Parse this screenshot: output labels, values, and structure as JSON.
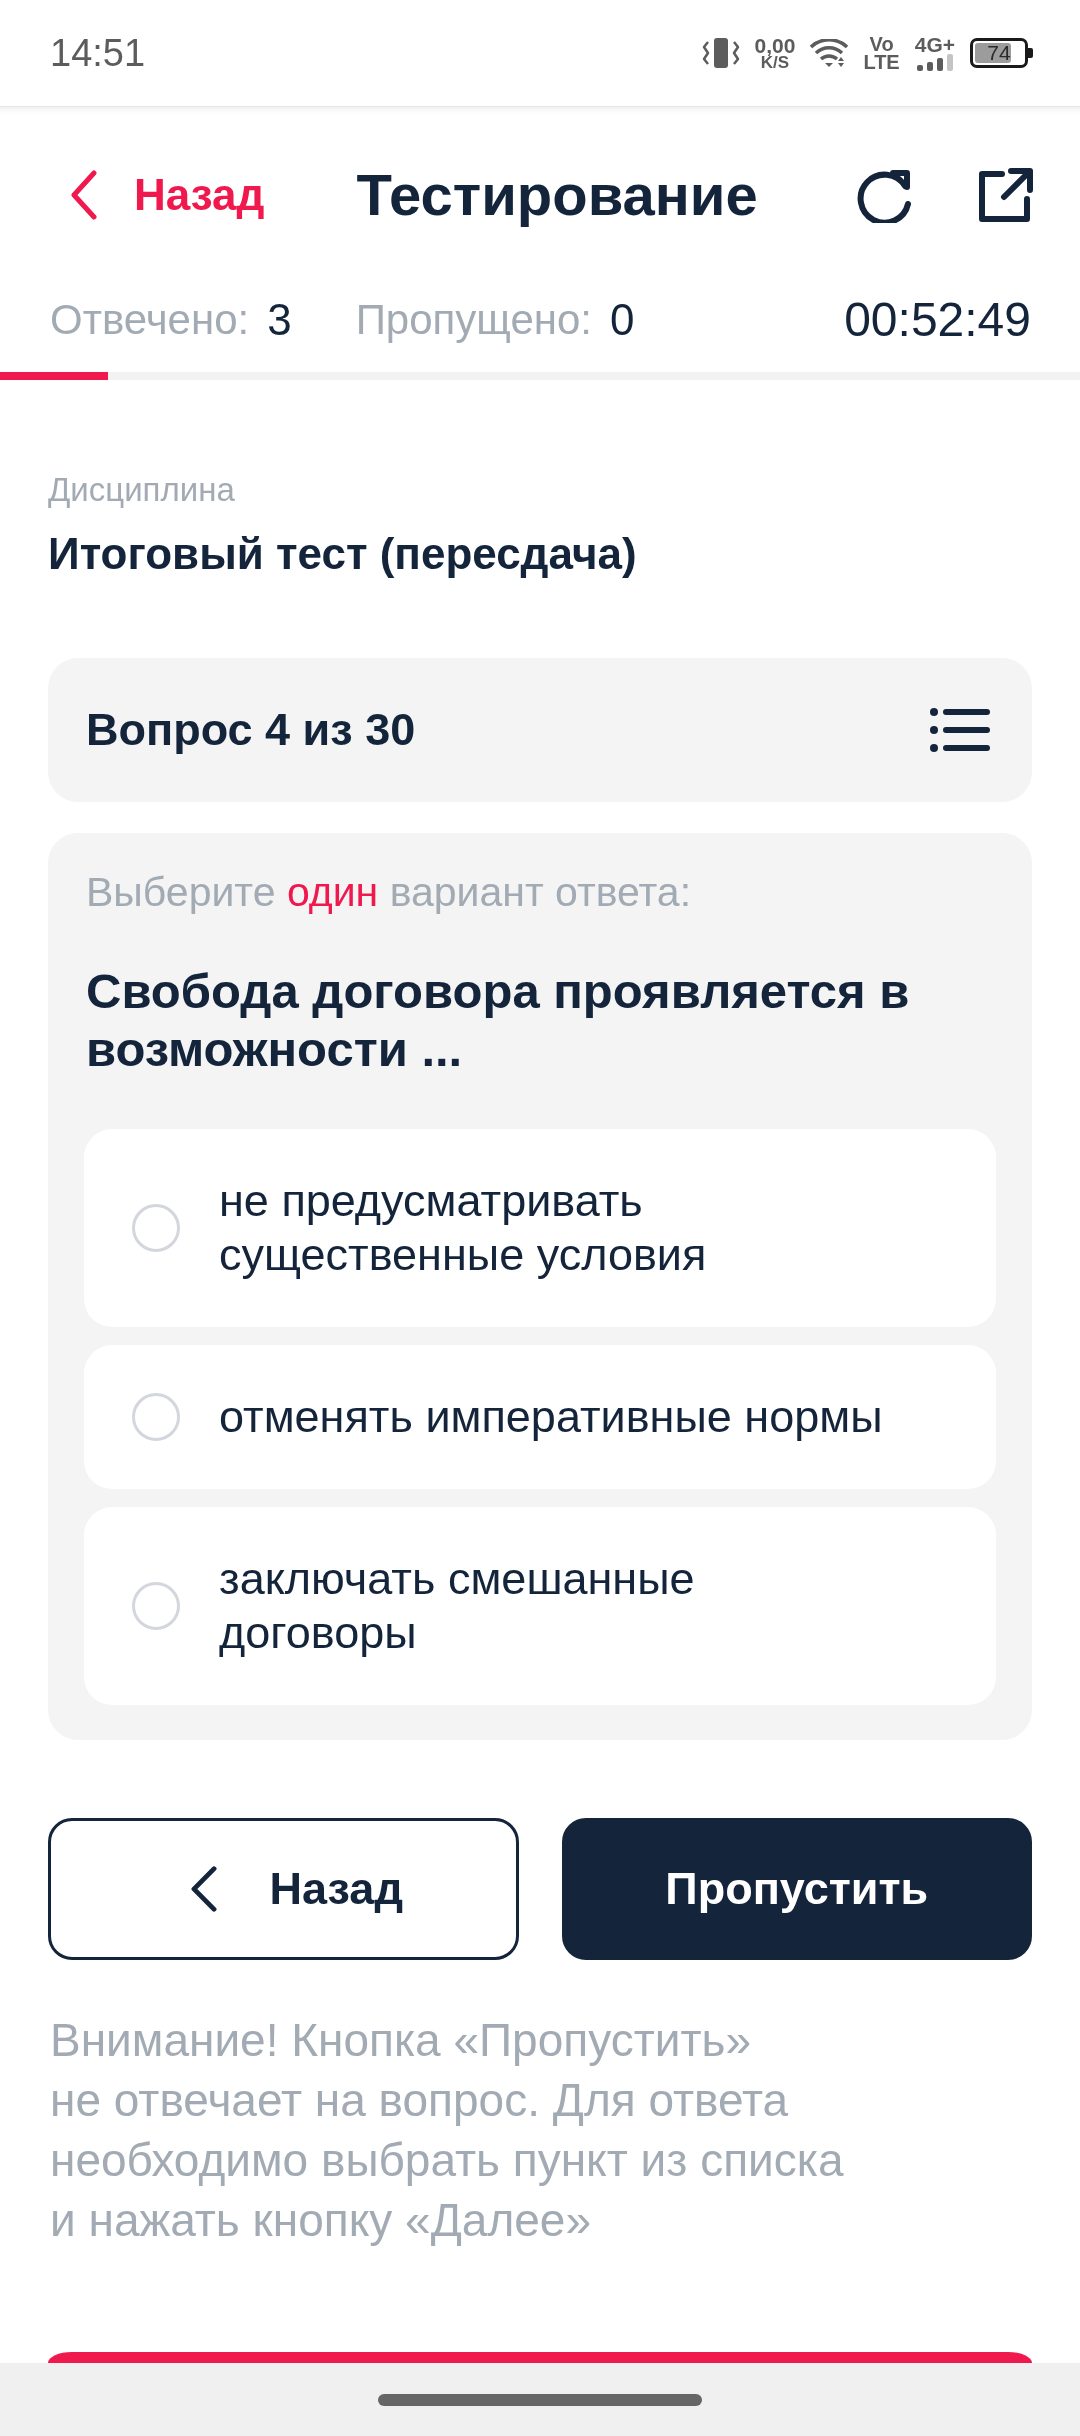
{
  "status_bar": {
    "time": "14:51",
    "network_speed": "0,00",
    "network_speed_unit": "K/S",
    "volte_top": "Vo",
    "volte_bottom": "LTE",
    "network_type": "4G+",
    "battery": "74"
  },
  "header": {
    "back": "Назад",
    "title": "Тестирование"
  },
  "stats": {
    "answered_label": "Отвечено:",
    "answered": "3",
    "skipped_label": "Пропущено:",
    "skipped": "0",
    "timer": "00:52:49"
  },
  "progress": {
    "level": 0.1
  },
  "discipline": {
    "label": "Дисциплина",
    "value": "Итоговый тест (пересдача)"
  },
  "question_header": {
    "title": "Вопрос 4 из 30"
  },
  "question": {
    "instruction": {
      "before": "Выберите",
      "highlight": "один",
      "after": "вариант ответа:"
    },
    "text": "Свобода договора проявляется в возможности ...",
    "options": [
      {
        "text": "не предусматривать существенные условия",
        "selected": false
      },
      {
        "text": "отменять императивные нормы",
        "selected": false
      },
      {
        "text": "заключать смешанные договоры",
        "selected": false
      }
    ]
  },
  "buttons": [
    {
      "kind": "back",
      "label": "Назад"
    },
    {
      "kind": "primary",
      "label": "Пропустить"
    }
  ],
  "note": "Внимание! Кнопка «Пропустить»\nне отвечает на вопрос. Для ответа\nнеобходимо выбрать пункт из списка\nи нажать кнопку «Далее»"
}
